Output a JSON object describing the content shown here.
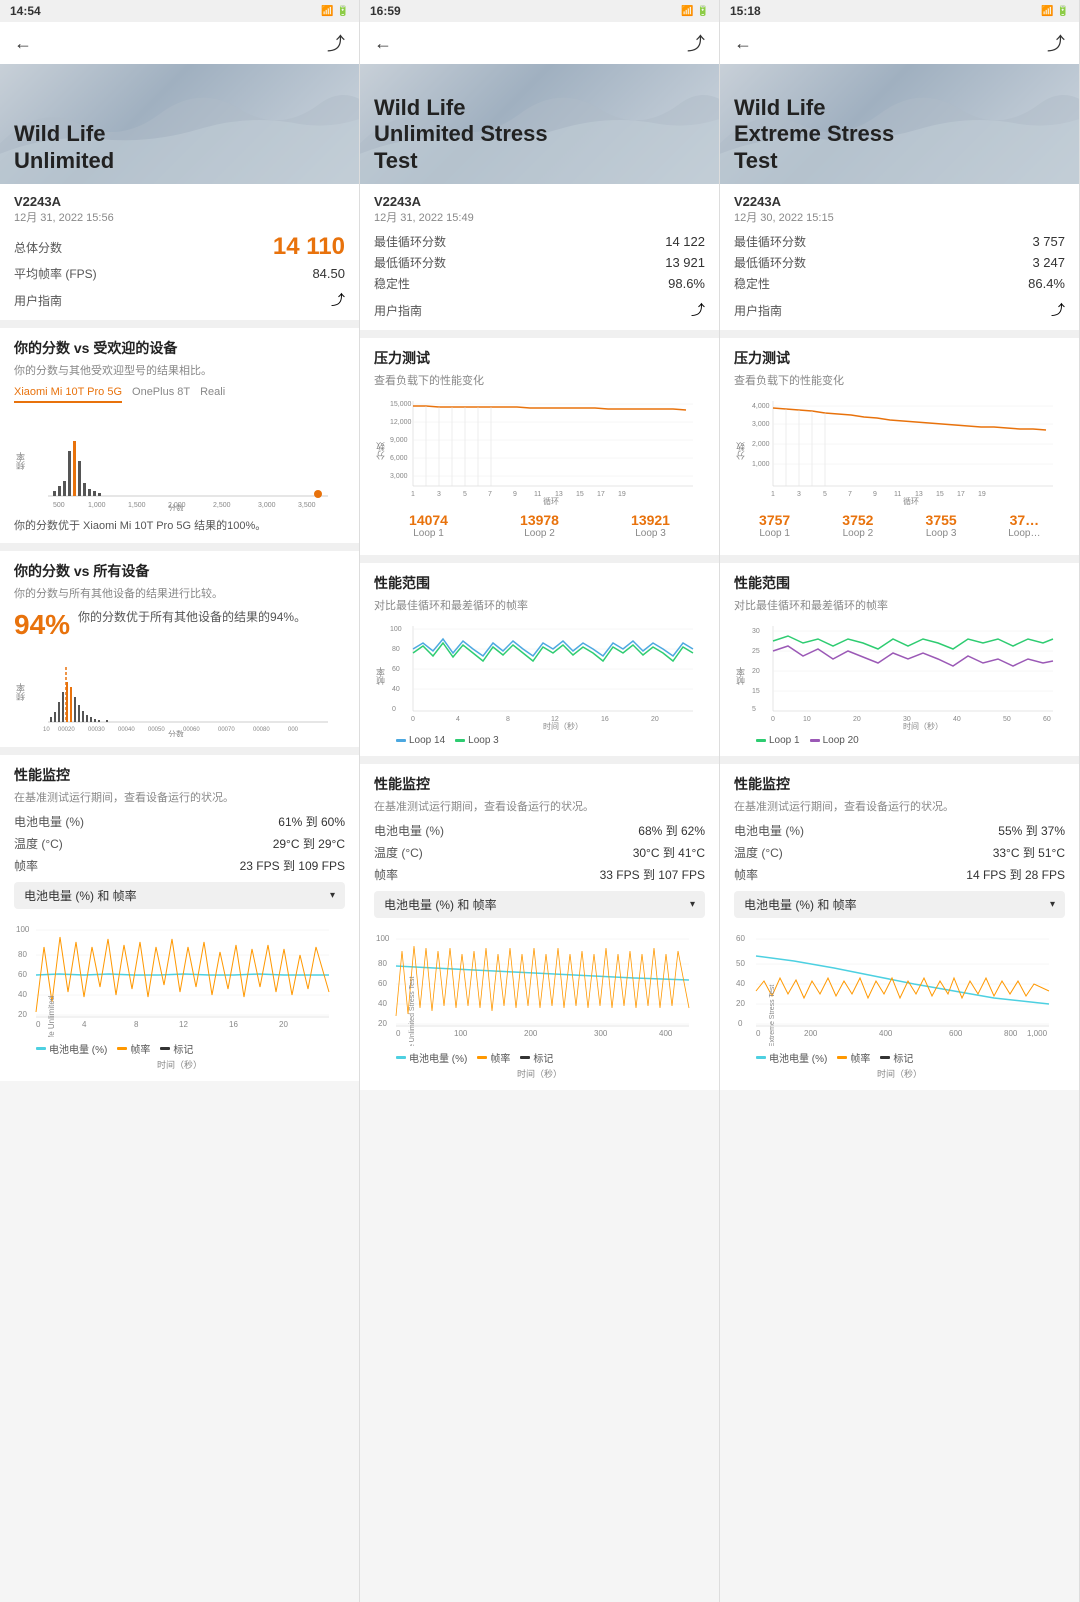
{
  "panels": [
    {
      "id": "panel1",
      "status_time": "14:54",
      "title": "Wild Life\nUnlimited",
      "device": "V2243A",
      "date": "12月 31, 2022 15:56",
      "total_score_label": "总体分数",
      "total_score": "14 110",
      "fps_label": "平均帧率 (FPS)",
      "fps_value": "84.50",
      "guide_label": "用户指南",
      "vs_popular_title": "你的分数 vs 受欢迎的设备",
      "vs_popular_sub": "你的分数与其他受欢迎型号的结果相比。",
      "tabs": [
        "Xiaomi Mi 10T Pro 5G",
        "OnePlus 8T",
        "Reali"
      ],
      "active_tab": 0,
      "chart_note": "你的分数优于 Xiaomi Mi 10T Pro 5G 结果的100%。",
      "vs_all_title": "你的分数 vs 所有设备",
      "vs_all_sub": "你的分数与所有其他设备的结果进行比较。",
      "pct": "94%",
      "pct_desc": "你的分数优于所有其他设备的结果的94%。",
      "monitor_title": "性能监控",
      "monitor_sub": "在基准测试运行期间，查看设备运行的状况。",
      "monitor_items": [
        {
          "key": "电池电量 (%)",
          "val": "61% 到 60%"
        },
        {
          "key": "温度 (°C)",
          "val": "29°C 到 29°C"
        },
        {
          "key": "帧率",
          "val": "23 FPS 到 109 FPS"
        }
      ],
      "dropdown_label": "电池电量 (%) 和 帧率",
      "type": "unlimited"
    },
    {
      "id": "panel2",
      "status_time": "16:59",
      "title": "Wild Life\nUnlimited Stress\nTest",
      "device": "V2243A",
      "date": "12月 31, 2022 15:49",
      "best_loop_label": "最佳循环分数",
      "best_loop_val": "14 122",
      "low_loop_label": "最低循环分数",
      "low_loop_val": "13 921",
      "stability_label": "稳定性",
      "stability_val": "98.6%",
      "guide_label": "用户指南",
      "stress_title": "压力测试",
      "stress_sub": "查看负载下的性能变化",
      "loops": [
        {
          "score": "14074",
          "label": "Loop 1"
        },
        {
          "score": "13978",
          "label": "Loop 2"
        },
        {
          "score": "13921",
          "label": "Loop 3"
        }
      ],
      "perf_range_title": "性能范围",
      "perf_range_sub": "对比最佳循环和最差循环的帧率",
      "legend_items": [
        {
          "label": "Loop 14",
          "color": "#4ca8e0"
        },
        {
          "label": "Loop 3",
          "color": "#2ecc71"
        }
      ],
      "x_axis_label": "时间（秒）",
      "monitor_title": "性能监控",
      "monitor_sub": "在基准测试运行期间，查看设备运行的状况。",
      "monitor_items": [
        {
          "key": "电池电量 (%)",
          "val": "68% 到 62%"
        },
        {
          "key": "温度 (°C)",
          "val": "30°C 到 41°C"
        },
        {
          "key": "帧率",
          "val": "33 FPS 到 107 FPS"
        }
      ],
      "dropdown_label": "电池电量 (%) 和 帧率",
      "type": "stress"
    },
    {
      "id": "panel3",
      "status_time": "15:18",
      "title": "Wild Life\nExtreme Stress\nTest",
      "device": "V2243A",
      "date": "12月 30, 2022 15:15",
      "best_loop_label": "最佳循环分数",
      "best_loop_val": "3 757",
      "low_loop_label": "最低循环分数",
      "low_loop_val": "3 247",
      "stability_label": "稳定性",
      "stability_val": "86.4%",
      "guide_label": "用户指南",
      "stress_title": "压力测试",
      "stress_sub": "查看负载下的性能变化",
      "loops": [
        {
          "score": "3757",
          "label": "Loop 1"
        },
        {
          "score": "3752",
          "label": "Loop 2"
        },
        {
          "score": "3755",
          "label": "Loop 3"
        },
        {
          "score": "37…",
          "label": "Loop…"
        }
      ],
      "perf_range_title": "性能范围",
      "perf_range_sub": "对比最佳循环和最差循环的帧率",
      "legend_items": [
        {
          "label": "Loop 1",
          "color": "#2ecc71"
        },
        {
          "label": "Loop 20",
          "color": "#9b59b6"
        }
      ],
      "x_axis_label": "时间（秒）",
      "monitor_title": "性能监控",
      "monitor_sub": "在基准测试运行期间，查看设备运行的状况。",
      "monitor_items": [
        {
          "key": "电池电量 (%)",
          "val": "55% 到 37%"
        },
        {
          "key": "温度 (°C)",
          "val": "33°C 到 51°C"
        },
        {
          "key": "帧率",
          "val": "14 FPS 到 28 FPS"
        }
      ],
      "dropdown_label": "电池电量 (%) 和 帧率",
      "type": "extreme"
    }
  ],
  "icons": {
    "back": "←",
    "share": "⤴",
    "chevron_down": "▾"
  }
}
